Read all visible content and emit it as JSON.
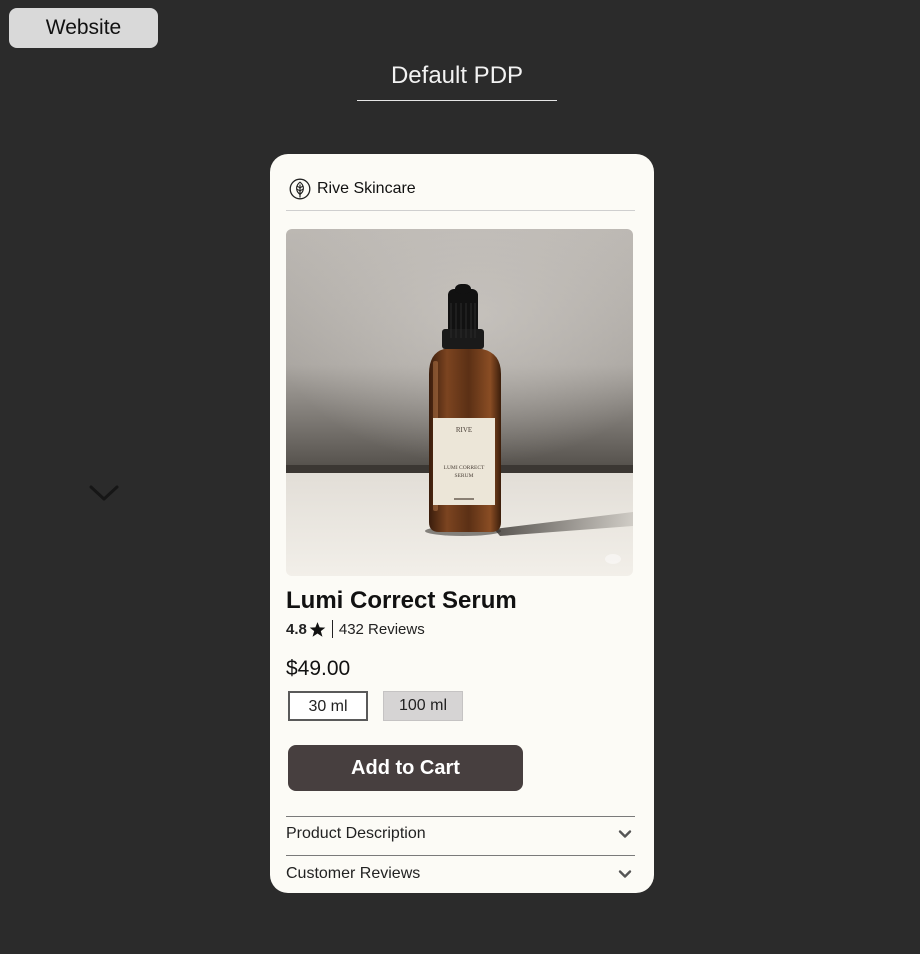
{
  "top_button": {
    "label": "Website"
  },
  "page": {
    "title": "Default PDP"
  },
  "card": {
    "brand": "Rive Skincare",
    "product": {
      "name": "Lumi Correct Serum",
      "rating": "4.8",
      "reviews": "432 Reviews",
      "price": "$49.00",
      "bottle_label": {
        "brand": "RIVE",
        "line1": "LUMI CORRECT",
        "line2": "SERUM"
      }
    },
    "sizes": [
      {
        "label": "30 ml",
        "selected": true
      },
      {
        "label": "100 ml",
        "selected": false
      }
    ],
    "cta": "Add to Cart",
    "accordions": [
      {
        "label": "Product Description",
        "icon": "chevron-down-icon"
      },
      {
        "label": "Customer Reviews",
        "icon": "chevron-down-icon"
      }
    ]
  },
  "colors": {
    "background": "#2b2b2b",
    "card": "#fcfbf6",
    "cta": "#473f3f",
    "selected_size_bg": "#d6d4d4"
  },
  "icons": {
    "brand_logo": "leaf-logo-icon",
    "rating": "star-icon",
    "navigation": "chevron-down-icon"
  }
}
